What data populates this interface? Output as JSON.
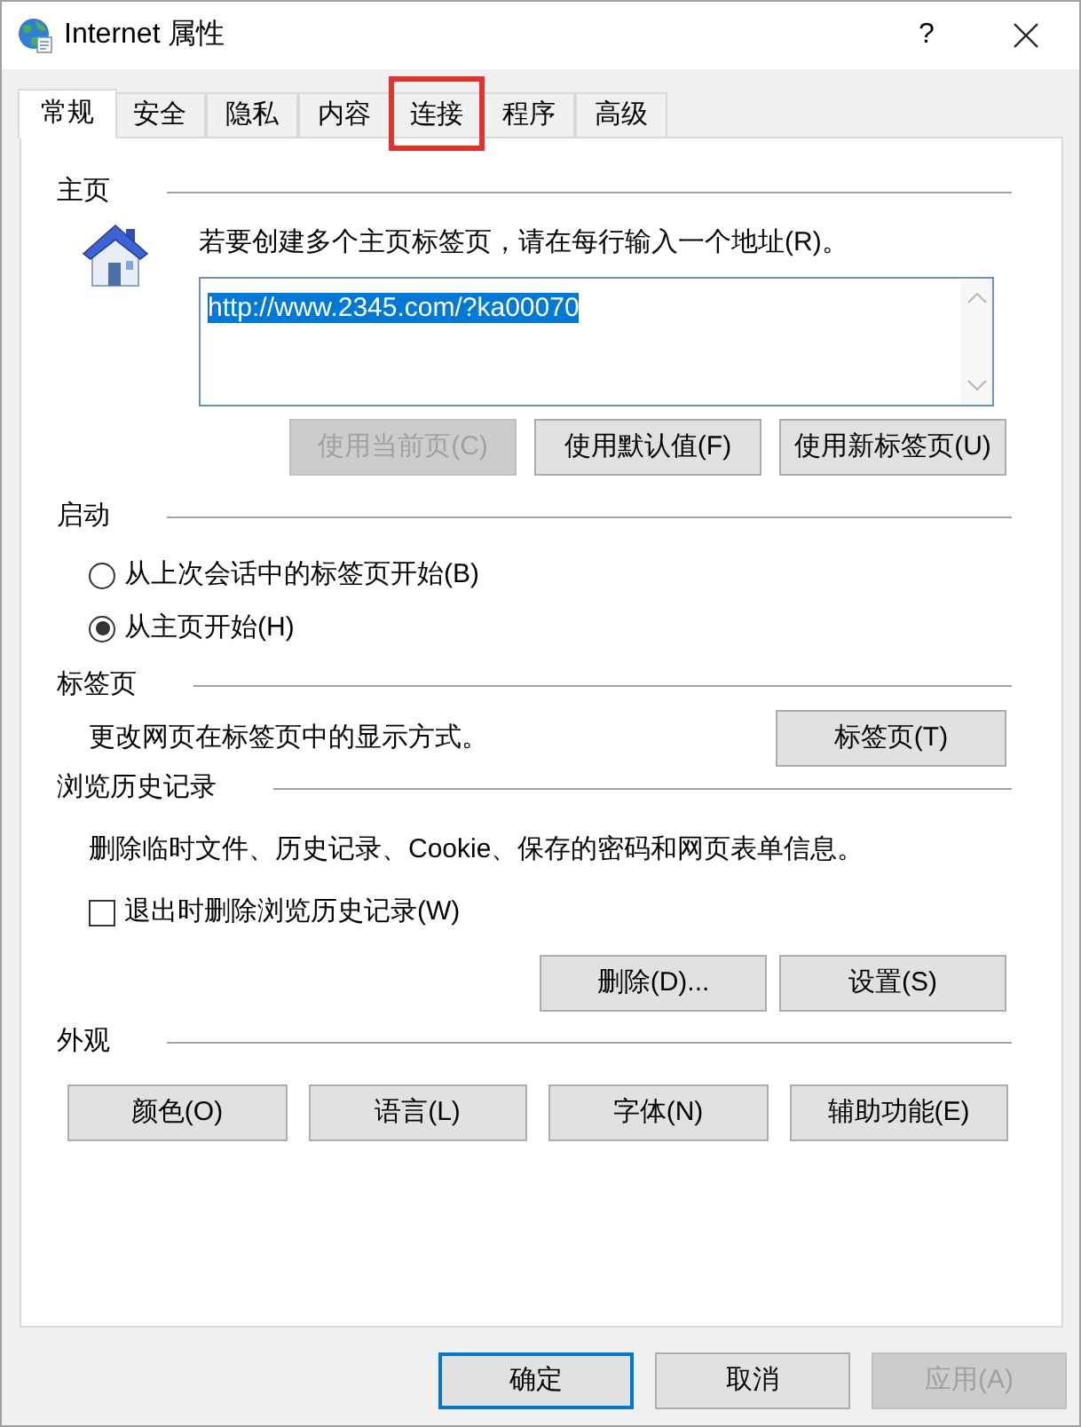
{
  "window": {
    "title": "Internet 属性",
    "help_button": "?"
  },
  "tabs": [
    {
      "label": "常规",
      "selected": true,
      "highlighted": false
    },
    {
      "label": "安全",
      "selected": false,
      "highlighted": false
    },
    {
      "label": "隐私",
      "selected": false,
      "highlighted": false
    },
    {
      "label": "内容",
      "selected": false,
      "highlighted": false
    },
    {
      "label": "连接",
      "selected": false,
      "highlighted": true
    },
    {
      "label": "程序",
      "selected": false,
      "highlighted": false
    },
    {
      "label": "高级",
      "selected": false,
      "highlighted": false
    }
  ],
  "home_page": {
    "heading": "主页",
    "instruction": "若要创建多个主页标签页，请在每行输入一个地址(R)。",
    "address_box": {
      "value": "http://www.2345.com/?ka00070",
      "text_selected": true
    },
    "buttons": [
      {
        "label": "使用当前页(C)",
        "disabled": true
      },
      {
        "label": "使用默认值(F)",
        "disabled": false
      },
      {
        "label": "使用新标签页(U)",
        "disabled": false
      }
    ]
  },
  "startup": {
    "heading": "启动",
    "options": [
      {
        "label": "从上次会话中的标签页开始(B)",
        "selected": false
      },
      {
        "label": "从主页开始(H)",
        "selected": true
      }
    ]
  },
  "tab_settings": {
    "heading": "标签页",
    "description": "更改网页在标签页中的显示方式。",
    "button": {
      "label": "标签页(T)",
      "disabled": false
    }
  },
  "browsing_history": {
    "heading": "浏览历史记录",
    "description": "删除临时文件、历史记录、Cookie、保存的密码和网页表单信息。",
    "delete_on_exit": {
      "label": "退出时删除浏览历史记录(W)",
      "checked": false
    },
    "buttons": [
      {
        "label": "删除(D)...",
        "disabled": false
      },
      {
        "label": "设置(S)",
        "disabled": false
      }
    ]
  },
  "appearance": {
    "heading": "外观",
    "buttons": [
      {
        "label": "颜色(O)",
        "disabled": false
      },
      {
        "label": "语言(L)",
        "disabled": false
      },
      {
        "label": "字体(N)",
        "disabled": false
      },
      {
        "label": "辅助功能(E)",
        "disabled": false
      }
    ]
  },
  "dialog_buttons": [
    {
      "label": "确定",
      "focused": true,
      "disabled": false
    },
    {
      "label": "取消",
      "focused": false,
      "disabled": false
    },
    {
      "label": "应用(A)",
      "focused": false,
      "disabled": true
    }
  ]
}
